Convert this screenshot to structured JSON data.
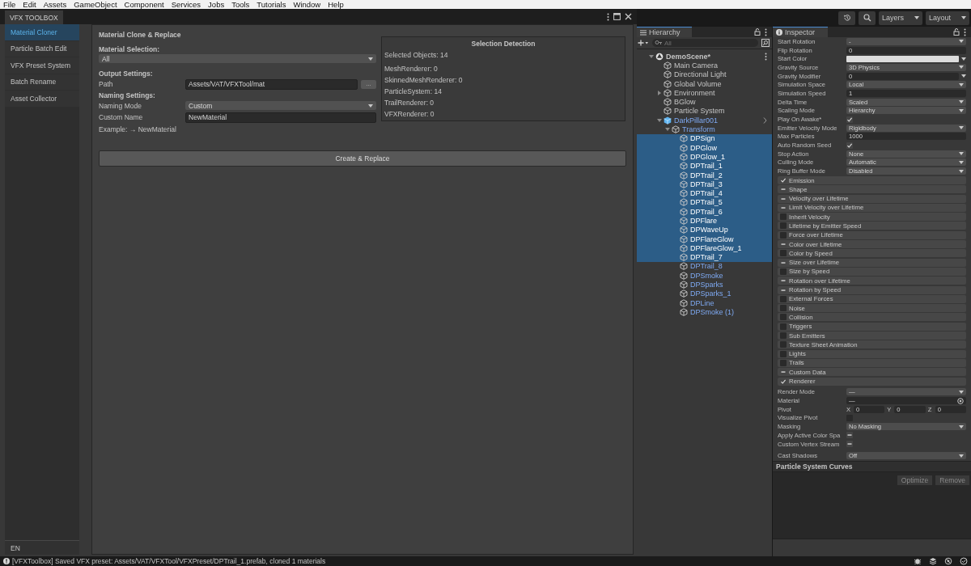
{
  "menu_bar": [
    "File",
    "Edit",
    "Assets",
    "GameObject",
    "Component",
    "Services",
    "Jobs",
    "Tools",
    "Tutorials",
    "Window",
    "Help"
  ],
  "toolbox": {
    "title": "VFX TOOLBOX",
    "nav": [
      {
        "label": "Material Cloner",
        "selected": true
      },
      {
        "label": "Particle Batch Edit",
        "selected": false
      },
      {
        "label": "VFX Preset System",
        "selected": false
      },
      {
        "label": "Batch Rename",
        "selected": false
      },
      {
        "label": "Asset Collector",
        "selected": false
      }
    ],
    "language": "EN",
    "panel": {
      "title": "Material Clone & Replace",
      "material_selection": {
        "label": "Material Selection:",
        "value": "All"
      },
      "output_settings": {
        "label": "Output Settings:",
        "path_label": "Path",
        "path": "Assets/VAT/VFXTool/mat",
        "browse": "..."
      },
      "naming_settings": {
        "label": "Naming Settings:",
        "mode_label": "Naming Mode",
        "mode": "Custom",
        "name_label": "Custom Name",
        "name": "NewMaterial",
        "example": "Example: → NewMaterial"
      },
      "selection_detection": {
        "title": "Selection Detection",
        "lines": [
          "Selected Objects: 14",
          "MeshRenderer: 0",
          "SkinnedMeshRenderer: 0",
          "ParticleSystem: 14",
          "TrailRenderer: 0",
          "VFXRenderer: 0"
        ]
      },
      "action": "Create & Replace"
    }
  },
  "toolbar": {
    "layers": "Layers",
    "layout": "Layout"
  },
  "hierarchy": {
    "title": "Hierarchy",
    "search_placeholder": "All",
    "tree": [
      {
        "name": "DemoScene*",
        "kind": "scene",
        "selected": false,
        "expanded": true,
        "children": [
          {
            "name": "Main Camera",
            "kind": "object",
            "selected": false
          },
          {
            "name": "Directional Light",
            "kind": "object",
            "selected": false
          },
          {
            "name": "Global Volume",
            "kind": "object",
            "selected": false
          },
          {
            "name": "Environment",
            "kind": "object",
            "selected": false,
            "expanded": false
          },
          {
            "name": "BGlow",
            "kind": "object",
            "selected": false
          },
          {
            "name": "Particle System",
            "kind": "object",
            "selected": false
          },
          {
            "name": "DarkPillar001",
            "kind": "prefab_root",
            "selected": false,
            "expanded": true,
            "children": [
              {
                "name": "Transform",
                "kind": "prefab",
                "selected": false,
                "expanded": true,
                "children": [
                  {
                    "name": "DPSign",
                    "kind": "prefab",
                    "selected": true
                  },
                  {
                    "name": "DPGlow",
                    "kind": "prefab",
                    "selected": true
                  },
                  {
                    "name": "DPGlow_1",
                    "kind": "prefab",
                    "selected": true
                  },
                  {
                    "name": "DPTrail_1",
                    "kind": "prefab",
                    "selected": true
                  },
                  {
                    "name": "DPTrail_2",
                    "kind": "prefab",
                    "selected": true
                  },
                  {
                    "name": "DPTrail_3",
                    "kind": "prefab",
                    "selected": true
                  },
                  {
                    "name": "DPTrail_4",
                    "kind": "prefab",
                    "selected": true
                  },
                  {
                    "name": "DPTrail_5",
                    "kind": "prefab",
                    "selected": true
                  },
                  {
                    "name": "DPTrail_6",
                    "kind": "prefab",
                    "selected": true
                  },
                  {
                    "name": "DPFlare",
                    "kind": "prefab",
                    "selected": true
                  },
                  {
                    "name": "DPWaveUp",
                    "kind": "prefab",
                    "selected": true
                  },
                  {
                    "name": "DPFlareGlow",
                    "kind": "prefab",
                    "selected": true
                  },
                  {
                    "name": "DPFlareGlow_1",
                    "kind": "prefab",
                    "selected": true
                  },
                  {
                    "name": "DPTrail_7",
                    "kind": "prefab",
                    "selected": true
                  },
                  {
                    "name": "DPTrail_8",
                    "kind": "prefab",
                    "selected": false
                  },
                  {
                    "name": "DPSmoke",
                    "kind": "prefab",
                    "selected": false
                  },
                  {
                    "name": "DPSparks",
                    "kind": "prefab",
                    "selected": false
                  },
                  {
                    "name": "DPSparks_1",
                    "kind": "prefab",
                    "selected": false
                  },
                  {
                    "name": "DPLine",
                    "kind": "prefab",
                    "selected": false
                  },
                  {
                    "name": "DPSmoke (1)",
                    "kind": "prefab",
                    "selected": false
                  }
                ]
              }
            ]
          }
        ]
      }
    ]
  },
  "inspector": {
    "title": "Inspector",
    "properties": [
      {
        "label": "Start Rotation",
        "kind": "dropdown",
        "value": "-"
      },
      {
        "label": "Flip Rotation",
        "kind": "field",
        "value": "0"
      },
      {
        "label": "Start Color",
        "kind": "color",
        "color": "#dcdcdc"
      },
      {
        "label": "Gravity Source",
        "kind": "dropdown",
        "value": "3D Physics"
      },
      {
        "label": "Gravity Modifier",
        "kind": "curve",
        "value": "0"
      },
      {
        "label": "Simulation Space",
        "kind": "dropdown",
        "value": "Local"
      },
      {
        "label": "Simulation Speed",
        "kind": "field",
        "value": "1"
      },
      {
        "label": "Delta Time",
        "kind": "dropdown",
        "value": "Scaled"
      },
      {
        "label": "Scaling Mode",
        "kind": "dropdown",
        "value": "Hierarchy"
      },
      {
        "label": "Play On Awake*",
        "kind": "checkbox",
        "checked": true,
        "mixed": false
      },
      {
        "label": "Emitter Velocity Mode",
        "kind": "dropdown",
        "value": "Rigidbody"
      },
      {
        "label": "Max Particles",
        "kind": "field",
        "value": "1000"
      },
      {
        "label": "Auto Random Seed",
        "kind": "checkbox",
        "checked": true,
        "mixed": false
      },
      {
        "label": "Stop Action",
        "kind": "dropdown",
        "value": "None"
      },
      {
        "label": "Culling Mode",
        "kind": "dropdown",
        "value": "Automatic"
      },
      {
        "label": "Ring Buffer Mode",
        "kind": "dropdown",
        "value": "Disabled"
      }
    ],
    "modules": [
      {
        "name": "Emission",
        "checked": true,
        "mixed": false
      },
      {
        "name": "Shape",
        "checked": false,
        "mixed": true
      },
      {
        "name": "Velocity over Lifetime",
        "checked": false,
        "mixed": true
      },
      {
        "name": "Limit Velocity over Lifetime",
        "checked": false,
        "mixed": true
      },
      {
        "name": "Inherit Velocity",
        "checked": false,
        "mixed": false
      },
      {
        "name": "Lifetime by Emitter Speed",
        "checked": false,
        "mixed": false
      },
      {
        "name": "Force over Lifetime",
        "checked": false,
        "mixed": false
      },
      {
        "name": "Color over Lifetime",
        "checked": false,
        "mixed": true
      },
      {
        "name": "Color by Speed",
        "checked": false,
        "mixed": false
      },
      {
        "name": "Size over Lifetime",
        "checked": false,
        "mixed": true
      },
      {
        "name": "Size by Speed",
        "checked": false,
        "mixed": false
      },
      {
        "name": "Rotation over Lifetime",
        "checked": false,
        "mixed": true
      },
      {
        "name": "Rotation by Speed",
        "checked": false,
        "mixed": true
      },
      {
        "name": "External Forces",
        "checked": false,
        "mixed": false
      },
      {
        "name": "Noise",
        "checked": false,
        "mixed": false
      },
      {
        "name": "Collision",
        "checked": false,
        "mixed": false
      },
      {
        "name": "Triggers",
        "checked": false,
        "mixed": false
      },
      {
        "name": "Sub Emitters",
        "checked": false,
        "mixed": false
      },
      {
        "name": "Texture Sheet Animation",
        "checked": false,
        "mixed": false
      },
      {
        "name": "Lights",
        "checked": false,
        "mixed": false
      },
      {
        "name": "Trails",
        "checked": false,
        "mixed": false
      },
      {
        "name": "Custom Data",
        "checked": false,
        "mixed": true
      },
      {
        "name": "Renderer",
        "checked": true,
        "mixed": false
      }
    ],
    "renderer_properties": [
      {
        "label": "Render Mode",
        "kind": "dropdown",
        "value": "—"
      },
      {
        "label": "Material",
        "kind": "object",
        "value": "—"
      },
      {
        "label": "Pivot",
        "kind": "vector",
        "axes": [
          {
            "label": "X",
            "value": "0"
          },
          {
            "label": "Y",
            "value": "0"
          },
          {
            "label": "Z",
            "value": "0"
          }
        ]
      },
      {
        "label": "Visualize Pivot",
        "kind": "checkbox",
        "checked": false,
        "mixed": false
      },
      {
        "label": "Masking",
        "kind": "dropdown",
        "value": "No Masking"
      },
      {
        "label": "Apply Active Color Spa",
        "kind": "checkbox",
        "checked": false,
        "mixed": true
      },
      {
        "label": "Custom Vertex Stream",
        "kind": "checkbox",
        "checked": false,
        "mixed": true
      },
      {
        "label": "Cast Shadows",
        "kind": "dropdown",
        "value": "Off"
      }
    ],
    "curves_title": "Particle System Curves",
    "buttons": [
      "Optimize",
      "Remove"
    ]
  },
  "status_bar": {
    "message": "[VFXToolbox] Saved VFX preset: Assets/VAT/VFXTool/VFXPreset/DPTrail_1.prefab, cloned 1 materials"
  }
}
